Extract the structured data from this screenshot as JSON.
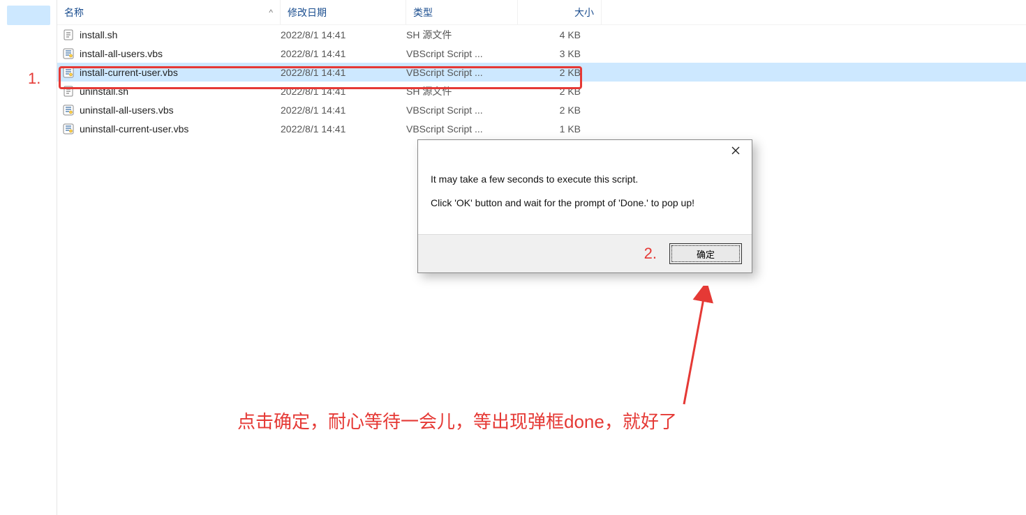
{
  "annotations": {
    "step1_label": "1.",
    "step2_label": "2.",
    "caption_text": "点击确定，耐心等待一会儿，等出现弹框done，就好了"
  },
  "headers": {
    "name": "名称",
    "date": "修改日期",
    "type": "类型",
    "size": "大小",
    "sort_indicator": "^"
  },
  "files": [
    {
      "name": "install.sh",
      "date": "2022/8/1 14:41",
      "type": "SH 源文件",
      "size": "4 KB",
      "icon": "sh",
      "highlight": false
    },
    {
      "name": "install-all-users.vbs",
      "date": "2022/8/1 14:41",
      "type": "VBScript Script ...",
      "size": "3 KB",
      "icon": "vbs",
      "highlight": false
    },
    {
      "name": "install-current-user.vbs",
      "date": "2022/8/1 14:41",
      "type": "VBScript Script ...",
      "size": "2 KB",
      "icon": "vbs",
      "highlight": true
    },
    {
      "name": "uninstall.sh",
      "date": "2022/8/1 14:41",
      "type": "SH 源文件",
      "size": "2 KB",
      "icon": "sh",
      "highlight": false
    },
    {
      "name": "uninstall-all-users.vbs",
      "date": "2022/8/1 14:41",
      "type": "VBScript Script ...",
      "size": "2 KB",
      "icon": "vbs",
      "highlight": false
    },
    {
      "name": "uninstall-current-user.vbs",
      "date": "2022/8/1 14:41",
      "type": "VBScript Script ...",
      "size": "1 KB",
      "icon": "vbs",
      "highlight": false
    }
  ],
  "dialog": {
    "line1": "It may take a few seconds to execute this script.",
    "line2": "Click 'OK' button and wait for the prompt of 'Done.' to pop up!",
    "ok_label": "确定"
  }
}
